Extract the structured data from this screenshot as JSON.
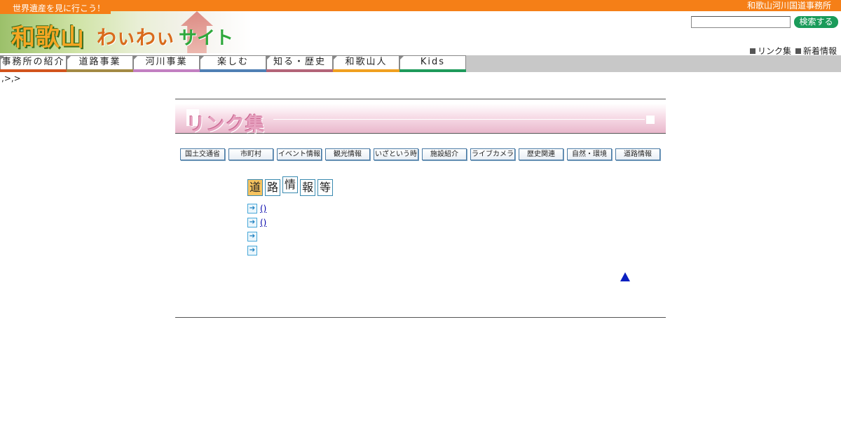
{
  "header": {
    "office_name": "和歌山河川国道事務所",
    "logo_tagline": "世界遺産を見に行こう！",
    "logo_main": "和歌山",
    "logo_wai": "わぃわぃ",
    "logo_site": "サイト",
    "search_placeholder": "",
    "search_button": "検索する",
    "utility_links": [
      "リンク集",
      "新着情報"
    ]
  },
  "nav": {
    "tabs": [
      "事務所の紹介",
      "道路事業",
      "河川事業",
      "楽しむ",
      "知る・歴史",
      "和歌山人",
      "Kids"
    ]
  },
  "breadcrumb": ",>,>",
  "main": {
    "banner_title": "リンク集",
    "categories": [
      "国土交通省",
      "市町村",
      "イベント情報",
      "観光情報",
      "いざという時",
      "施設紹介",
      "ライブカメラ",
      "歴史関連",
      "自然・環境",
      "道路情報"
    ],
    "section_title_chars": [
      "道",
      "路",
      "情",
      "報",
      "等"
    ],
    "links": [
      "()",
      "()",
      "",
      ""
    ]
  },
  "colors": {
    "topbar": "#f57f17",
    "search_button": "#1a9b5a",
    "banner_pink": "#e9b8cc",
    "link": "#0000aa",
    "back_to_top": "#0a1fc0"
  }
}
